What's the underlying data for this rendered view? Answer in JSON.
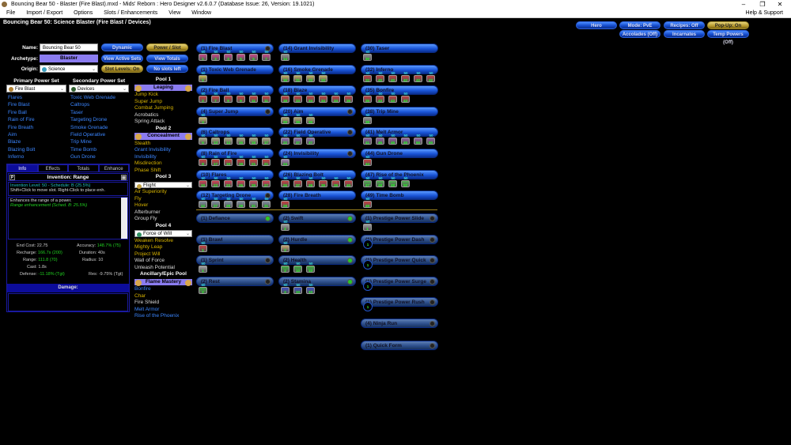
{
  "window": {
    "title": "Bouncing Bear 50 - Blaster (Fire Blast).mxd - Mids' Reborn : Hero Designer v2.6.0.7 (Database Issue: 26, Version: 19.1021)"
  },
  "menu": [
    "File",
    "Import / Export",
    "Options",
    "Slots / Enhancements",
    "View",
    "Window"
  ],
  "menu_help": "Help & Support",
  "build_title": "Bouncing Bear 50: Science Blaster (Fire Blast / Devices)",
  "top_buttons": {
    "hero": "Hero",
    "mode": "Mode: PvE",
    "recipes": "Recipes: Off",
    "popup": "Pop-Up: On",
    "accolades": "Accolades (Off)",
    "incarnates": "Incarnates",
    "temp": "Temp Powers (Off)"
  },
  "char": {
    "name_label": "Name:",
    "name": "Bouncing Bear 50",
    "archetype_label": "Archetype:",
    "archetype": "Blaster",
    "origin_label": "Origin:",
    "origin": "Science"
  },
  "buttons": {
    "dynamic": "Dynamic",
    "power_slot": "Power / Slot",
    "view_active_sets": "View Active Sets",
    "view_totals": "View Totals",
    "slot_levels": "Slot Levels: On",
    "no_slots": "No slots left"
  },
  "primary": {
    "header": "Primary Power Set",
    "selected": "Fire Blast",
    "powers": [
      "Flares",
      "Fire Blast",
      "Fire Ball",
      "Rain of Fire",
      "Fire Breath",
      "Aim",
      "Blaze",
      "Blazing Bolt",
      "Inferno"
    ]
  },
  "secondary": {
    "header": "Secondary Power Set",
    "selected": "Devices",
    "powers": [
      "Toxic Web Grenade",
      "Caltrops",
      "Taser",
      "Targeting Drone",
      "Smoke Grenade",
      "Field Operative",
      "Trip Mine",
      "Time Bomb",
      "Gun Drone"
    ]
  },
  "pools": [
    {
      "header": "Pool 1",
      "name": "Leaping",
      "powers": [
        [
          "Jump Kick",
          "y"
        ],
        [
          "Super Jump",
          "y"
        ],
        [
          "Combat Jumping",
          "y"
        ],
        [
          "Acrobatics",
          "w"
        ],
        [
          "Spring Attack",
          "w"
        ]
      ]
    },
    {
      "header": "Pool 2",
      "name": "Concealment",
      "powers": [
        [
          "Stealth",
          "y"
        ],
        [
          "Grant Invisibility",
          "b"
        ],
        [
          "Invisibility",
          "b"
        ],
        [
          "Misdirection",
          "y"
        ],
        [
          "Phase Shift",
          "y"
        ]
      ]
    },
    {
      "header": "Pool 3",
      "name": "Flight",
      "powers": [
        [
          "Air Superiority",
          "y"
        ],
        [
          "Fly",
          "y"
        ],
        [
          "Hover",
          "y"
        ],
        [
          "Afterburner",
          "w"
        ],
        [
          "Group Fly",
          "w"
        ]
      ]
    },
    {
      "header": "Pool 4",
      "name": "Force of Will",
      "powers": [
        [
          "Weaken Resolve",
          "y"
        ],
        [
          "Mighty Leap",
          "y"
        ],
        [
          "Project Will",
          "y"
        ],
        [
          "Wall of Force",
          "w"
        ],
        [
          "Unleash Potential",
          "w"
        ]
      ]
    },
    {
      "header": "Ancillary/Epic Pool",
      "name": "Flame Mastery",
      "powers": [
        [
          "Bonfire",
          "b"
        ],
        [
          "Char",
          "y"
        ],
        [
          "Fire Shield",
          "w"
        ],
        [
          "Melt Armor",
          "b"
        ],
        [
          "Rise of the Phoenix",
          "b"
        ]
      ]
    }
  ],
  "info": {
    "tabs": [
      "Info",
      "Effects",
      "Totals",
      "Enhance"
    ],
    "title": "Invention: Range",
    "level_line": "Invention Level: 50 - Schedule: B (25.5%)",
    "hint": "Shift+Click to move slot. Right-Click to place enh.",
    "desc": "Enhances the range of a power.",
    "desc2": "Range  enhancement (Sched. B: 25.5%)",
    "stats": {
      "end_cost": "End Cost:",
      "end_cost_v": "22.75",
      "accuracy": "Accuracy:",
      "accuracy_v": "148.7% (75)",
      "recharge": "Recharge:",
      "recharge_v": "166.7s (200)",
      "duration": "Duration:",
      "duration_v": "40s",
      "range": "Range:",
      "range_v": "111.8 (70)",
      "radius": "Radius:",
      "radius_v": "10",
      "cast": "Cast:",
      "cast_v": "1.8s",
      "defense": "Defense:",
      "defense_v": "-11.18% (Tgt)",
      "res": "Res:",
      "res_v": "-9.75% (Tgt)"
    },
    "damage": "Damage:"
  },
  "colors": {
    "accent": "#1a55d8",
    "gold": "#b89a2c",
    "pool_bar": "#8b7cf0"
  },
  "powers": [
    [
      {
        "name": "(1) Fire Blast",
        "slots": [
          1,
          3,
          3,
          5,
          5,
          7
        ],
        "c": "#c84a8a",
        "dot": "off"
      },
      {
        "name": "(1) Toxic Web Grenade",
        "slots": [
          1
        ],
        "c": "#c8b84a"
      },
      {
        "name": "(2) Fire Ball",
        "slots": [
          2,
          7,
          9,
          9,
          11,
          11
        ],
        "c": "#c84040"
      },
      {
        "name": "(4) Super Jump",
        "slots": [
          4
        ],
        "c": "#c8b870",
        "dot": "off"
      },
      {
        "name": "(6) Caltrops",
        "slots": [
          6,
          13,
          13,
          15,
          15,
          17
        ],
        "c": "#a8a880"
      },
      {
        "name": "(8) Rain of Fire",
        "slots": [
          8,
          17,
          19,
          19,
          21,
          21
        ],
        "c": "#c84040"
      },
      {
        "name": "(10) Flares",
        "slots": [
          10,
          23,
          23,
          25,
          25,
          27
        ],
        "c": "#d04050"
      },
      {
        "name": "(12) Targeting Drone",
        "slots": [
          12,
          27,
          29,
          29,
          31,
          31
        ],
        "c": "#8090a0",
        "dot": "off"
      }
    ],
    [
      {
        "name": "(14) Grant Invisibility",
        "slots": [
          14
        ],
        "c": "#909090"
      },
      {
        "name": "(16) Smoke Grenade",
        "slots": [
          16,
          31,
          33,
          33
        ],
        "c": "#c0b060"
      },
      {
        "name": "(18) Blaze",
        "slots": [
          18,
          33,
          34,
          34,
          34,
          36
        ],
        "c": "#c04040"
      },
      {
        "name": "(20) Aim",
        "slots": [
          20,
          36,
          36
        ],
        "c": "#b0a870",
        "dot": "off"
      },
      {
        "name": "(22) Field Operative",
        "slots": [
          22,
          37,
          37
        ],
        "c": "#9070b0",
        "dot": "off"
      },
      {
        "name": "(24) Invisibility",
        "slots": [
          24
        ],
        "c": "#a080b0",
        "dot": "off"
      },
      {
        "name": "(26) Blazing Bolt",
        "slots": [
          26,
          37,
          39,
          39,
          39,
          40
        ],
        "c": "#c04040"
      },
      {
        "name": "(28) Fire Breath",
        "slots": [
          28
        ],
        "c": "#c84040"
      }
    ],
    [
      {
        "name": "(30) Taser",
        "slots": [
          30
        ],
        "c": "#909090"
      },
      {
        "name": "(32) Inferno",
        "slots": [
          32,
          40,
          40,
          42,
          42,
          42
        ],
        "c": "#c04040"
      },
      {
        "name": "(35) Bonfire",
        "slots": [
          35,
          43,
          43,
          43
        ],
        "c": "#c04040"
      },
      {
        "name": "(38) Trip Mine",
        "slots": [
          38
        ],
        "c": "#909090"
      },
      {
        "name": "(41) Melt Armor",
        "slots": [
          41,
          45,
          45,
          45,
          50,
          50
        ],
        "c": "#9060a0"
      },
      {
        "name": "(44) Gun Drone",
        "slots": [
          44
        ],
        "c": "#c84040"
      },
      {
        "name": "(47) Rise of the Phoenix",
        "slots": [
          47,
          48,
          48,
          50
        ],
        "c": "#50b050"
      },
      {
        "name": "(49) Time Bomb",
        "slots": [
          49
        ],
        "c": "#c84040"
      }
    ]
  ],
  "inherents": [
    [
      {
        "name": "(1) Defiance",
        "slots": [],
        "dot": "on"
      },
      {
        "name": "(1) Brawl",
        "slots": [
          1
        ],
        "c": "#c84040"
      },
      {
        "name": "(1) Sprint",
        "slots": [
          1
        ],
        "c": "#a0a0a0",
        "dot": "off"
      },
      {
        "name": "(2) Rest",
        "slots": [
          2
        ],
        "c": "#40b040",
        "dot": "off"
      }
    ],
    [
      {
        "name": "(2) Swift",
        "slots": [
          2
        ],
        "c": "#a0a0a0",
        "dot": "on"
      },
      {
        "name": "(2) Hurdle",
        "slots": [
          2
        ],
        "c": "#c8a870",
        "dot": "on"
      },
      {
        "name": "(2) Health",
        "slots": [
          2,
          10,
          10
        ],
        "c": "#40b040",
        "dot": "on"
      },
      {
        "name": "(2) Stamina",
        "slots": [
          2,
          10,
          10
        ],
        "c": "#4050c0",
        "dot": "on"
      }
    ],
    [
      {
        "name": "(1) Prestige Power Slide",
        "slots": [
          1
        ],
        "c": "#a0a0a0",
        "dot": "off"
      },
      {
        "name": "(1) Prestige Power Dash",
        "slots": [
          1
        ],
        "empty": true,
        "dot": "off"
      },
      {
        "name": "(1) Prestige Power Quick",
        "slots": [
          1
        ],
        "empty": true,
        "dot": "off"
      },
      {
        "name": "(1) Prestige Power Surge",
        "slots": [
          1
        ],
        "empty": true,
        "dot": "off"
      },
      {
        "name": "(1) Prestige Power Rush",
        "slots": [
          1
        ],
        "empty": true,
        "dot": "off"
      },
      {
        "name": "(4) Ninja Run",
        "slots": [],
        "dot": "off"
      },
      {
        "name": "(1) Quick Form",
        "slots": [],
        "dot": "off",
        "gap": true
      }
    ]
  ],
  "enh_level": "50"
}
